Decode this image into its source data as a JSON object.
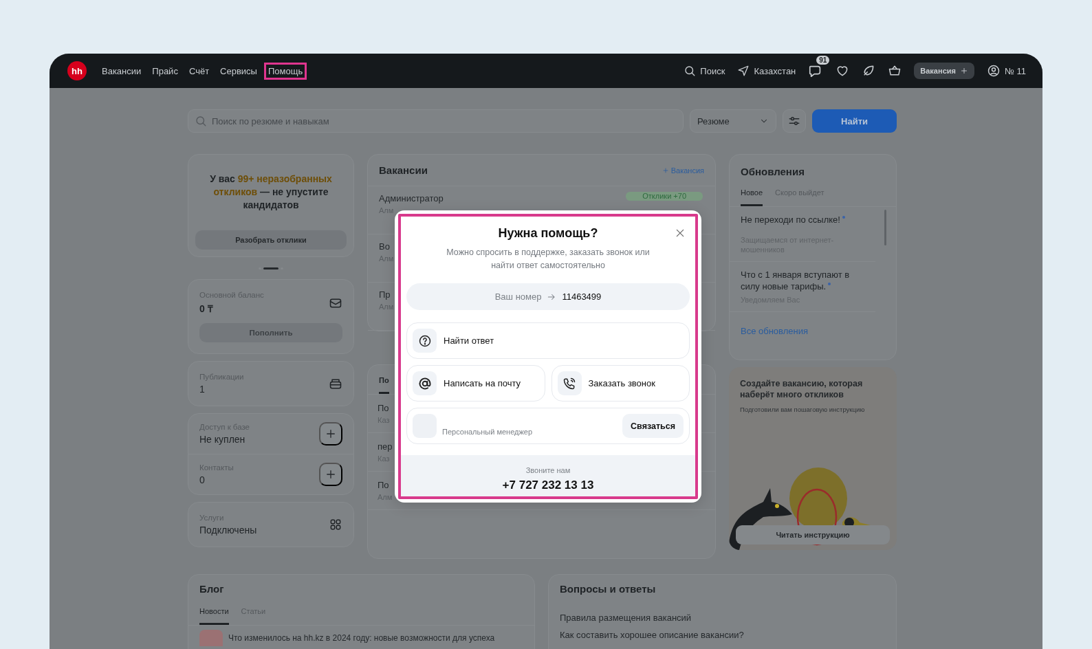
{
  "header": {
    "logo": "hh",
    "nav": [
      {
        "label": "Вакансии",
        "highlighted": false
      },
      {
        "label": "Прайс",
        "highlighted": false
      },
      {
        "label": "Счёт",
        "highlighted": false
      },
      {
        "label": "Сервисы",
        "highlighted": false
      },
      {
        "label": "Помощь",
        "highlighted": true
      }
    ],
    "search_label": "Поиск",
    "location": "Казахстан",
    "messages_badge": "91",
    "vacancy_button": "Вакансия",
    "account": "№ 11"
  },
  "search": {
    "placeholder": "Поиск по резюме и навыкам",
    "scope": "Резюме",
    "submit": "Найти"
  },
  "left": {
    "promo": {
      "before": "У вас ",
      "highlight": "99+ неразобранных откликов",
      "after": " — не упустите кандидатов",
      "button": "Разобрать отклики"
    },
    "carousel_dots": [
      {
        "selected": false
      },
      {
        "selected": true
      },
      {
        "selected": false
      }
    ],
    "balance": {
      "label": "Основной баланс",
      "value": "0 ₸",
      "button": "Пополнить"
    },
    "publications": {
      "label": "Публикации",
      "value": "1"
    },
    "access": [
      {
        "label": "Доступ к базе",
        "value": "Не куплен"
      },
      {
        "label": "Контакты",
        "value": "0"
      }
    ],
    "services": {
      "label": "Услуги",
      "value": "Подключены"
    }
  },
  "vacancies": {
    "title": "Вакансии",
    "add_link": "Вакансия",
    "rows": [
      {
        "title": "Администратор",
        "city": "Алм",
        "badge": "Отклики +70"
      },
      {
        "title": "Во",
        "city": "Алм"
      },
      {
        "title": "Пр",
        "city": "Алм"
      }
    ]
  },
  "vacancies_2": {
    "tab": "По",
    "rows": [
      {
        "title": "По",
        "city": "Каз"
      },
      {
        "title": "пер",
        "city": "Каз"
      },
      {
        "title": "По",
        "city": "Алм"
      }
    ]
  },
  "updates": {
    "title": "Обновления",
    "tabs": [
      {
        "label": "Новое",
        "selected": true
      },
      {
        "label": "Скоро выйдет",
        "selected": false
      }
    ],
    "items": [
      {
        "title": "Не переходи по ссылке!",
        "subtitle": "Защищаемся от интернет-мошенников",
        "unread": true
      },
      {
        "title": "Что с 1 января вступают в силу новые тарифы.",
        "subtitle": "Уведомляем Вас",
        "unread": true
      }
    ],
    "all_link": "Все обновления"
  },
  "guide": {
    "title": "Создайте вакансию, которая наберёт много откликов",
    "subtitle": "Подготовили вам пошаговую инструкцию",
    "button": "Читать инструкцию"
  },
  "blog": {
    "title": "Блог",
    "tabs": [
      {
        "label": "Новости",
        "selected": true
      },
      {
        "label": "Статьи",
        "selected": false
      }
    ],
    "article": "Что изменилось на hh.kz в 2024 году: новые возможности для успеха"
  },
  "faq": {
    "title": "Вопросы и ответы",
    "links": [
      "Правила размещения вакансий",
      "Как составить хорошее описание вакансии?"
    ]
  },
  "modal": {
    "highlighted": true,
    "title": "Нужна помощь?",
    "subtitle": "Можно спросить в поддержке, заказать звонок или найти ответ самостоятельно",
    "number_label": "Ваш номер",
    "number": "11463499",
    "options": [
      {
        "kind": "question",
        "label": "Найти ответ"
      },
      {
        "kind": "email",
        "label": "Написать на почту"
      },
      {
        "kind": "call",
        "label": "Заказать звонок"
      }
    ],
    "manager": {
      "label": "Персональный менеджер",
      "button": "Связаться"
    },
    "footer_label": "Звоните нам",
    "phone": "+7 727 232 13 13"
  }
}
